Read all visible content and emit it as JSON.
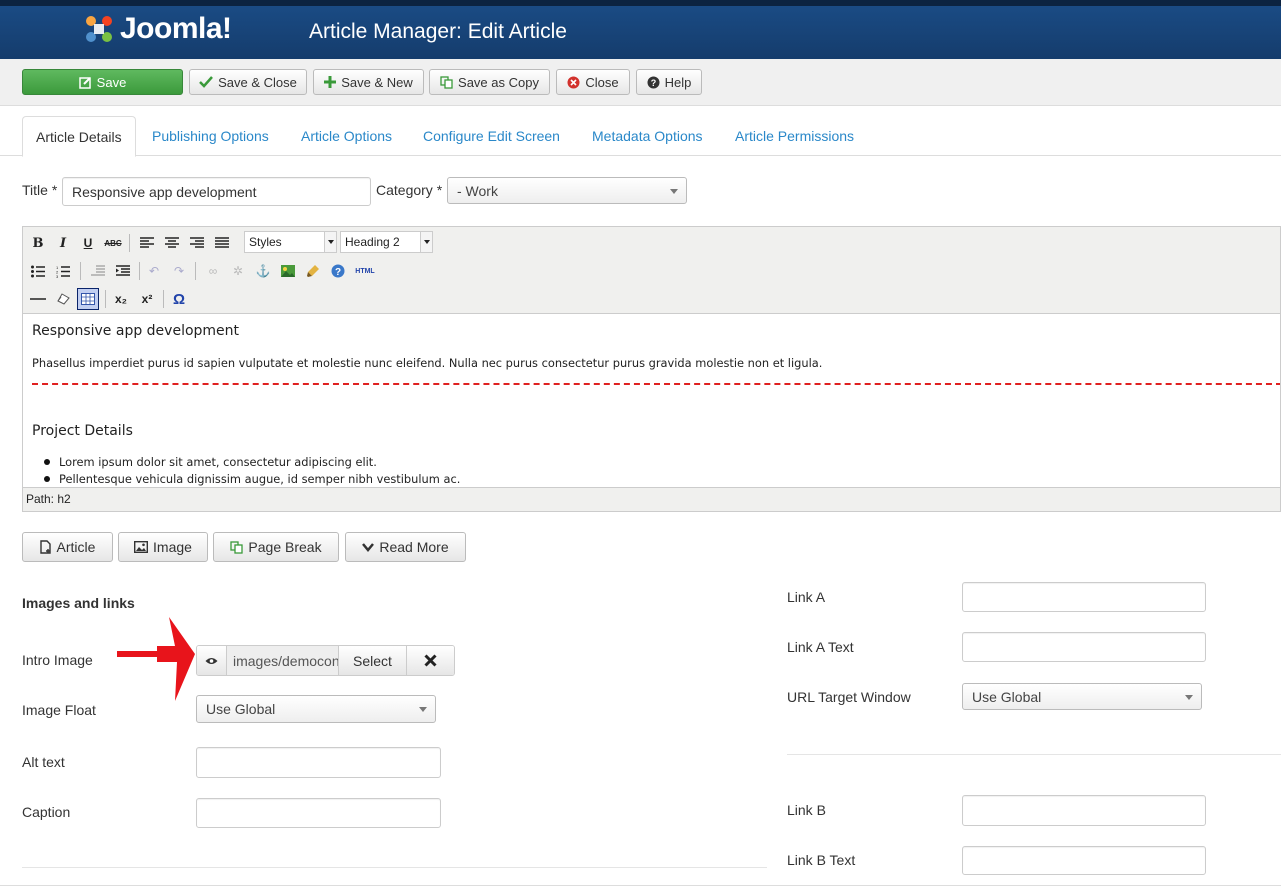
{
  "header": {
    "logo_text": "Joomla!",
    "title": "Article Manager: Edit Article"
  },
  "toolbar": {
    "save": "Save",
    "save_close": "Save & Close",
    "save_new": "Save & New",
    "save_copy": "Save as Copy",
    "close": "Close",
    "help": "Help"
  },
  "tabs": [
    "Article Details",
    "Publishing Options",
    "Article Options",
    "Configure Edit Screen",
    "Metadata Options",
    "Article Permissions"
  ],
  "form": {
    "title_label": "Title *",
    "title_value": "Responsive app development",
    "category_label": "Category *",
    "category_value": "- Work"
  },
  "editor": {
    "styles": "Styles",
    "format": "Heading 2",
    "html_label": "HTML",
    "heading1": "Responsive app development",
    "para1": "Phasellus imperdiet purus id sapien vulputate et molestie nunc eleifend. Nulla nec purus consectetur purus gravida molestie non et ligula.",
    "heading2": "Project Details",
    "bullets": [
      "Lorem ipsum dolor sit amet, consectetur adipiscing elit.",
      "Pellentesque vehicula dignissim augue, id semper nibh vestibulum ac."
    ],
    "path": "Path: h2"
  },
  "editor_buttons": {
    "article": "Article",
    "image": "Image",
    "page_break": "Page Break",
    "read_more": "Read More"
  },
  "images": {
    "section_title": "Images and links",
    "intro_image_label": "Intro Image",
    "intro_image_value": "images/democontent",
    "select_label": "Select",
    "image_float_label": "Image Float",
    "image_float_value": "Use Global",
    "alt_label": "Alt text",
    "caption_label": "Caption"
  },
  "links": {
    "link_a_label": "Link A",
    "link_a_text_label": "Link A Text",
    "url_target_label": "URL Target Window",
    "url_target_value": "Use Global",
    "link_b_label": "Link B",
    "link_b_text_label": "Link B Text"
  },
  "colors": {
    "header": "#1a4b84",
    "save_green": "#4cae4c",
    "link_blue": "#2a88c9",
    "arrow_red": "#e8141b"
  }
}
